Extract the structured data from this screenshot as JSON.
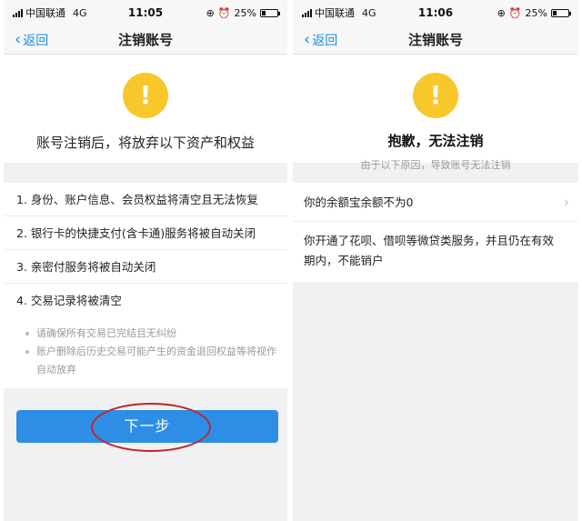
{
  "screens": [
    {
      "status": {
        "carrier": "中国联通",
        "network": "4G",
        "time": "11:05",
        "battery": "25%"
      },
      "nav": {
        "back_label": "返回",
        "title": "注销账号"
      },
      "icon": "warning-icon",
      "warning_symbol": "!",
      "headline": "账号注销后，将放弃以下资产和权益",
      "items": [
        "1. 身份、账户信息、会员权益将清空且无法恢复",
        "2. 银行卡的快捷支付(含卡通)服务将被自动关闭",
        "3. 亲密付服务将被自动关闭",
        "4. 交易记录将被清空"
      ],
      "notes": [
        "请确保所有交易已完结且无纠纷",
        "账户删除后历史交易可能产生的资金退回权益等将视作自动放弃"
      ],
      "next_button": "下一步"
    },
    {
      "status": {
        "carrier": "中国联通",
        "network": "4G",
        "time": "11:06",
        "battery": "25%"
      },
      "nav": {
        "back_label": "返回",
        "title": "注销账号"
      },
      "icon": "warning-icon",
      "warning_symbol": "!",
      "headline": "抱歉，无法注销",
      "subline": "由于以下原因，导致账号无法注销",
      "reasons": [
        "你的余额宝余额不为0",
        "你开通了花呗、借呗等微贷类服务，并且仍在有效期内，不能销户"
      ]
    }
  ],
  "colors": {
    "accent_blue": "#2e8ee6",
    "link_blue": "#1a8fe3",
    "warning_yellow": "#f8c72a",
    "annotation_red": "#c0262e",
    "page_gray": "#f1f1f3"
  },
  "battery_level": 0.25
}
